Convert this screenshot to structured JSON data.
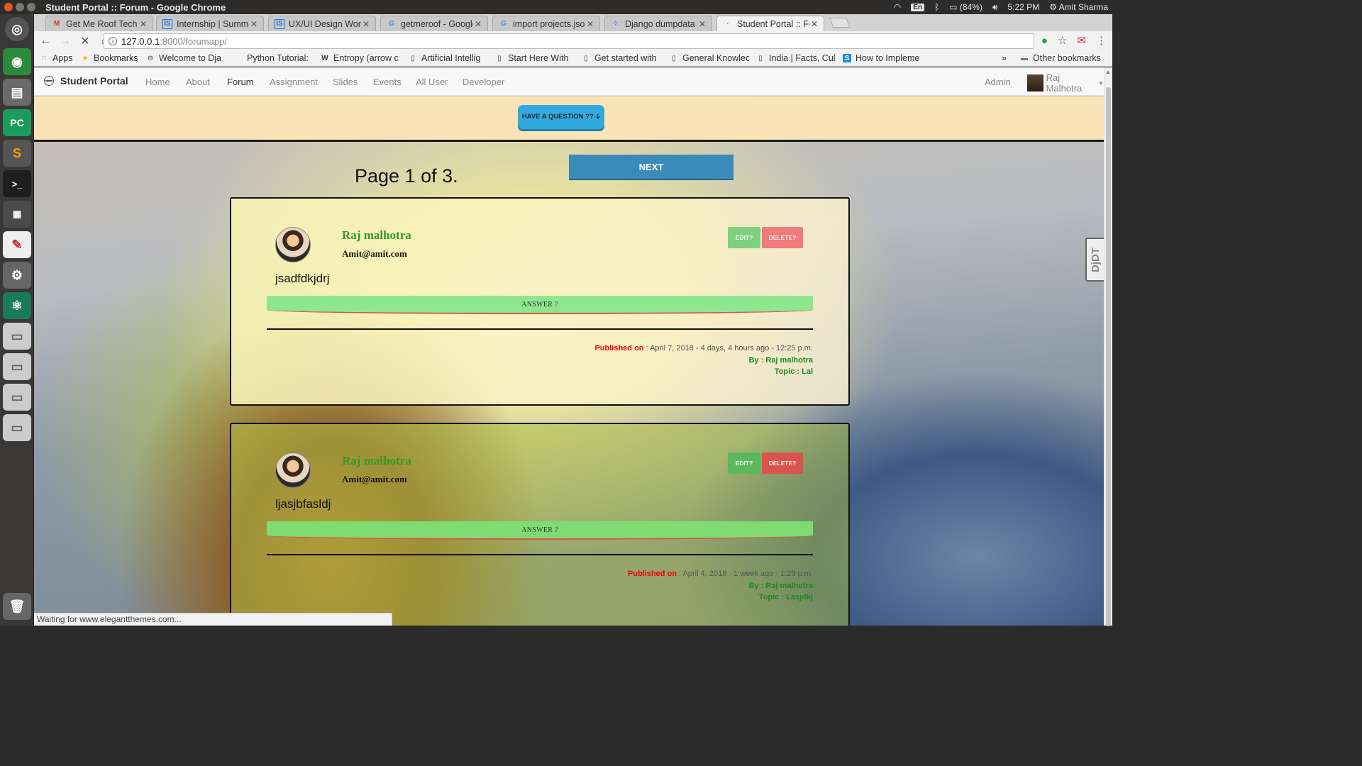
{
  "window": {
    "title": "Student Portal :: Forum - Google Chrome"
  },
  "tray": {
    "lang": "En",
    "battery": "(84%)",
    "time": "5:22 PM",
    "user": "Amit Sharma"
  },
  "tabs": [
    {
      "label": "Get Me Roof Tech A",
      "icon": "gmail-icon",
      "color": "#d93025"
    },
    {
      "label": "Internship | Summe",
      "icon": "internshala-icon",
      "color": "#1a73e8"
    },
    {
      "label": "UX/UI Design Work",
      "icon": "internshala-icon",
      "color": "#1a73e8"
    },
    {
      "label": "getmeroof - Google",
      "icon": "google-icon",
      "color": "#4285f4"
    },
    {
      "label": "import projects.jso",
      "icon": "google-icon",
      "color": "#4285f4"
    },
    {
      "label": "Django dumpdata",
      "icon": "grid-icon",
      "color": "#1a73e8"
    },
    {
      "label": "Student Portal :: Fo",
      "icon": "page-icon",
      "color": "#e33"
    }
  ],
  "toolbar": {
    "url_host": "127.0.0.1",
    "url_path": ":8000/forumapp/"
  },
  "bookmarks": [
    {
      "label": "Apps",
      "icon": "apps-grid-icon"
    },
    {
      "label": "Bookmarks",
      "icon": "star-icon"
    },
    {
      "label": "Welcome to Dja",
      "icon": "portal-icon"
    },
    {
      "label": "Python Tutorial:",
      "icon": "page-icon"
    },
    {
      "label": "Entropy (arrow c",
      "icon": "wikipedia-icon"
    },
    {
      "label": "Artificial Intellig",
      "icon": "page-icon"
    },
    {
      "label": "Start Here With",
      "icon": "page-icon"
    },
    {
      "label": "Get started with",
      "icon": "page-icon"
    },
    {
      "label": "General Knowlec",
      "icon": "page-icon"
    },
    {
      "label": "India | Facts, Cul",
      "icon": "page-icon"
    },
    {
      "label": "How to Impleme",
      "icon": "s-icon"
    }
  ],
  "bookmarks_overflow": "»",
  "other_bookmarks": "Other bookmarks",
  "sitenav": {
    "brand": "Student Portal",
    "links": [
      "Home",
      "About",
      "Forum",
      "Assignment",
      "Slides",
      "Events",
      "All User",
      "Developer"
    ],
    "active": "Forum",
    "admin": "Admin",
    "user": "Raj Malhotra"
  },
  "band": {
    "ask_label": "HAVE A QUESTION ?? 🡣"
  },
  "pagination": {
    "label": "Page 1 of 3.",
    "next_label": "NEXT"
  },
  "questions": [
    {
      "name": "Raj malhotra",
      "email": "Amit@amit.com",
      "text": "jsadfdkjdrj",
      "edit": "EDIT?",
      "delete": "DELETE?",
      "answer": "ANSWER ?",
      "published_label": "Published on",
      "published": " : April 7, 2018 - 4 days, 4 hours ago - 12:25 p.m.",
      "by": "By : Raj malhotra",
      "topic": "Topic : Lal"
    },
    {
      "name": "Raj malhotra",
      "email": "Amit@amit.com",
      "text": "ljasjbfasldj",
      "edit": "EDIT?",
      "delete": "DELETE?",
      "answer": "ANSWER ?",
      "published_label": "Published on",
      "published": " : April 4, 2018 - 1 week ago - 1:29 p.m.",
      "by": "By : Raj malhotra",
      "topic": "Topic : Lasjdkj"
    }
  ],
  "djdt": "DjDT",
  "status": "Waiting for www.elegantthemes.com..."
}
